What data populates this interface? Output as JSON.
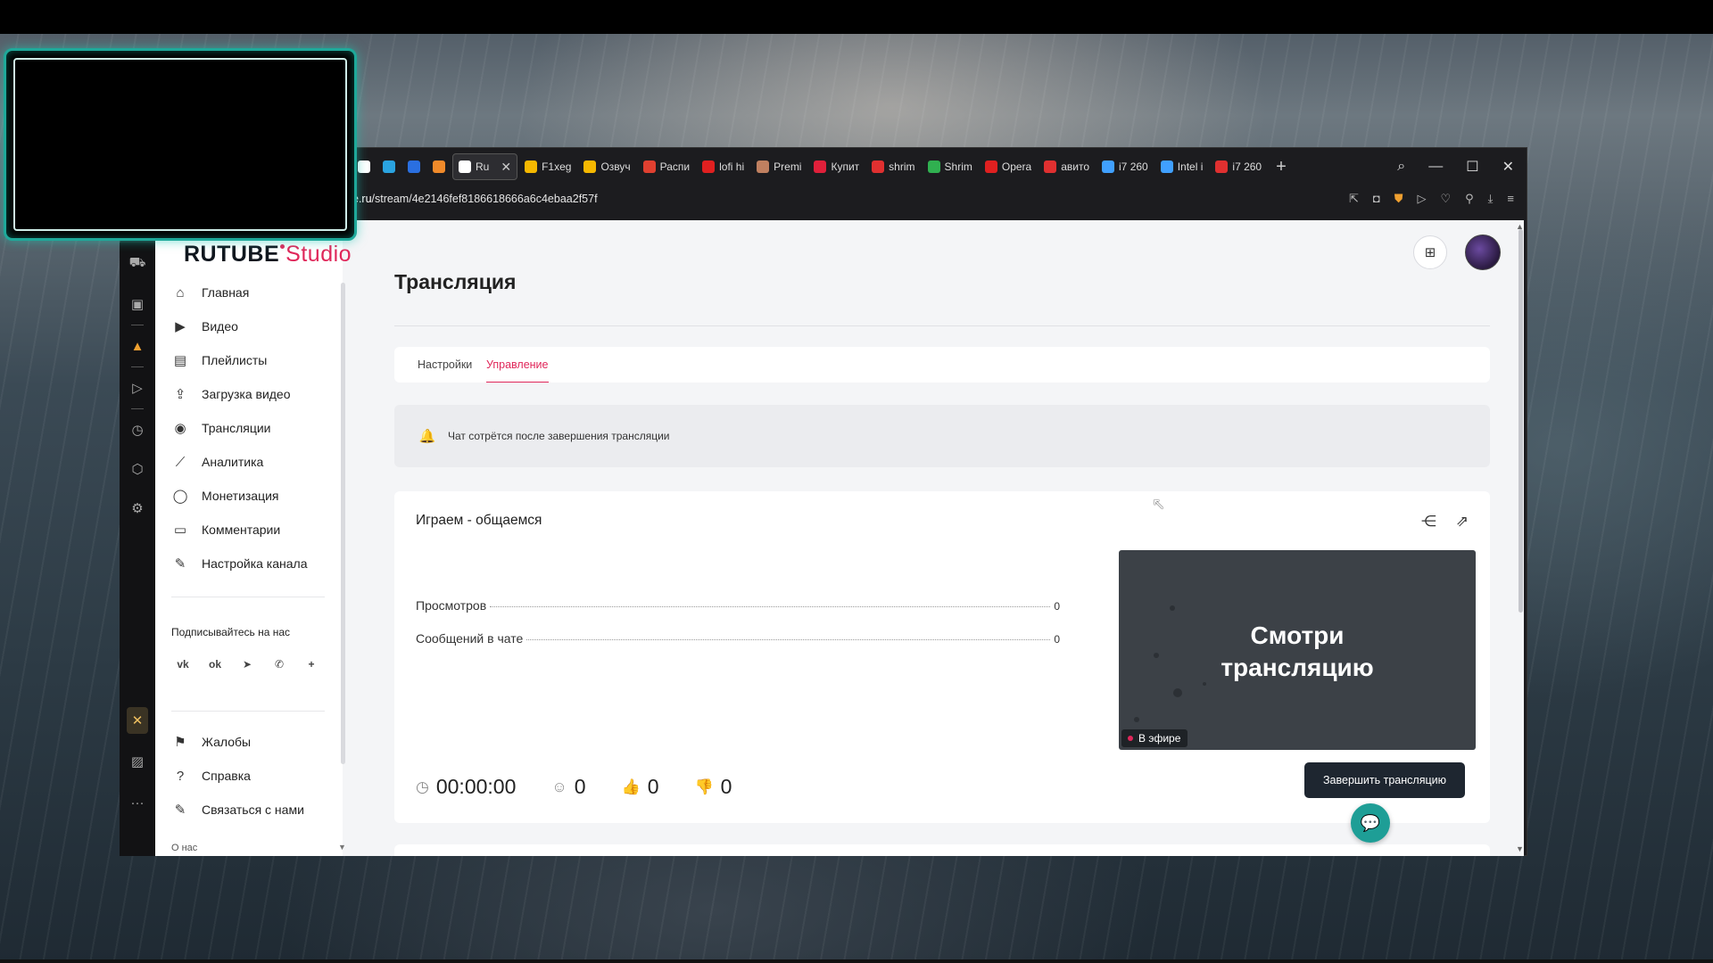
{
  "browser": {
    "tabs": [
      {
        "title": "",
        "color": "#ffffff",
        "icon": "rutube-favicon"
      },
      {
        "title": "",
        "color": "#2aa3e0",
        "icon": "telegram-favicon"
      },
      {
        "title": "",
        "color": "#2a6fe0",
        "icon": "chat-favicon"
      },
      {
        "title": "",
        "color": "#f08a2a",
        "icon": "dns-favicon"
      },
      {
        "title": "Ru",
        "color": "#ffffff",
        "icon": "rutube-favicon",
        "active": true
      },
      {
        "title": "F1xeg",
        "color": "#f5b800",
        "icon": "dzen-favicon"
      },
      {
        "title": "Озвуч",
        "color": "#f5b800",
        "icon": "dzen-favicon"
      },
      {
        "title": "Распи",
        "color": "#e04030",
        "icon": "store-favicon"
      },
      {
        "title": "lofi hi",
        "color": "#e02020",
        "icon": "youtube-favicon"
      },
      {
        "title": "Premi",
        "color": "#c08060",
        "icon": "premium-favicon"
      },
      {
        "title": "Купит",
        "color": "#e0203a",
        "icon": "shop-favicon"
      },
      {
        "title": "shrim",
        "color": "#e03030",
        "icon": "yandex-favicon"
      },
      {
        "title": "Shrim",
        "color": "#30b050",
        "icon": "shrimp-favicon"
      },
      {
        "title": "Opera",
        "color": "#e02020",
        "icon": "opera-favicon"
      },
      {
        "title": "авито",
        "color": "#e03030",
        "icon": "yandex-favicon"
      },
      {
        "title": "i7 260",
        "color": "#40a0ff",
        "icon": "avito-favicon"
      },
      {
        "title": "Intel i",
        "color": "#40a0ff",
        "icon": "avito-favicon"
      },
      {
        "title": "i7 260",
        "color": "#e03030",
        "icon": "yandex-favicon"
      }
    ],
    "url_host": "e.ru",
    "url_path": "/stream/4e2146fef8186618666a6c4ebaa2f57f"
  },
  "sidebar": {
    "logo_main": "RUTUBE",
    "logo_studio": "Studio",
    "items": [
      {
        "label": "Главная",
        "icon": "home-icon",
        "glyph": "⌂"
      },
      {
        "label": "Видео",
        "icon": "video-icon",
        "glyph": "▶"
      },
      {
        "label": "Плейлисты",
        "icon": "playlist-icon",
        "glyph": "▤"
      },
      {
        "label": "Загрузка видео",
        "icon": "upload-icon",
        "glyph": "⇪"
      },
      {
        "label": "Трансляции",
        "icon": "broadcast-icon",
        "glyph": "◉"
      },
      {
        "label": "Аналитика",
        "icon": "analytics-icon",
        "glyph": "⟋"
      },
      {
        "label": "Монетизация",
        "icon": "money-icon",
        "glyph": "◯"
      },
      {
        "label": "Комментарии",
        "icon": "comments-icon",
        "glyph": "▭"
      },
      {
        "label": "Настройка канала",
        "icon": "wand-icon",
        "glyph": "✎"
      }
    ],
    "follow_label": "Подписывайтесь на нас",
    "socials": [
      {
        "icon": "vk-icon",
        "glyph": "vk"
      },
      {
        "icon": "ok-icon",
        "glyph": "ok"
      },
      {
        "icon": "telegram-icon",
        "glyph": "➤"
      },
      {
        "icon": "viber-icon",
        "glyph": "✆"
      },
      {
        "icon": "plus-icon",
        "glyph": "+"
      }
    ],
    "bottom_items": [
      {
        "label": "Жалобы",
        "icon": "flag-icon",
        "glyph": "⚑"
      },
      {
        "label": "Справка",
        "icon": "help-icon",
        "glyph": "?"
      },
      {
        "label": "Связаться с нами",
        "icon": "edit-icon",
        "glyph": "✎"
      }
    ],
    "about_label": "О нас"
  },
  "main": {
    "title": "Трансляция",
    "tabs": [
      {
        "label": "Настройки",
        "active": false
      },
      {
        "label": "Управление",
        "active": true
      }
    ],
    "notice": "Чат сотрётся после завершения трансляции",
    "stream": {
      "title": "Играем - общаемся",
      "stats": [
        {
          "label": "Просмотров",
          "value": "0"
        },
        {
          "label": "Сообщений в чате",
          "value": "0"
        }
      ],
      "duration": "00:00:00",
      "viewers": "0",
      "likes": "0",
      "dislikes": "0",
      "preview_text_1": "Смотри",
      "preview_text_2": "трансляцию",
      "live_label": "В эфире",
      "end_button": "Завершить трансляцию"
    }
  },
  "colors": {
    "accent": "#e0275a",
    "dark_button": "#1e2630",
    "chat_fab": "#1e9e96"
  }
}
